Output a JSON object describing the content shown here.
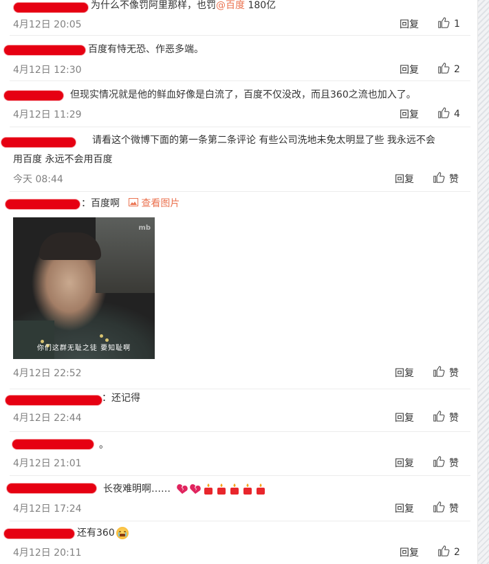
{
  "comments": [
    {
      "text_before": "为什么不像罚阿里那样，也罚",
      "mention": "@百度",
      "text_after": " 180亿",
      "time": "4月12日 20:05",
      "reply": "回复",
      "likes": "1"
    },
    {
      "text": "百度有恃无恐、作恶多端。",
      "time": "4月12日 12:30",
      "reply": "回复",
      "likes": "2"
    },
    {
      "text": "但现实情况就是他的鲜血好像是白流了，百度不仅没改，而且360之流也加入了。",
      "time": "4月12日 11:29",
      "reply": "回复",
      "likes": "4"
    },
    {
      "line1": "请看这个微博下面的第一条第二条评论 有些公司洗地未免太明显了些 我永远不会",
      "line2": "用百度 永远不会用百度",
      "time": "今天 08:44",
      "reply": "回复",
      "likes": "赞"
    },
    {
      "text": "：百度啊",
      "image_link": "查看图片",
      "image_caption": "你们这群无耻之徒 要知耻啊",
      "image_mark": "mb",
      "time": "4月12日 22:52",
      "reply": "回复",
      "likes": "赞"
    },
    {
      "text": "：还记得",
      "time": "4月12日 22:44",
      "reply": "回复",
      "likes": "赞"
    },
    {
      "text": "。",
      "time": "4月12日 21:01",
      "reply": "回复",
      "likes": "赞"
    },
    {
      "text": "长夜难明啊……",
      "time": "4月12日 17:24",
      "reply": "回复",
      "likes": "赞"
    },
    {
      "text": "还有360",
      "time": "4月12日 20:11",
      "reply": "回复",
      "likes": "2"
    }
  ],
  "colors": {
    "redaction": "#e60012",
    "link": "#eb7350",
    "time": "#808080"
  },
  "icons": {
    "like": "thumbs-up-icon",
    "image": "picture-icon",
    "emoji_candle": "candle-emoji",
    "emoji_heart": "broken-heart-emoji",
    "emoji_face": "crying-face-emoji"
  }
}
